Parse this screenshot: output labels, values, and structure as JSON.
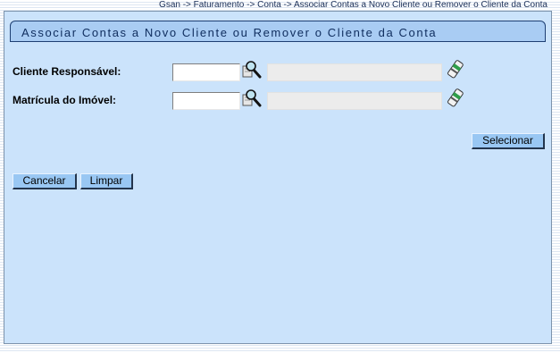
{
  "breadcrumb": "Gsan -> Faturamento -> Conta -> Associar Contas a Novo Cliente ou Remover o Cliente da Conta",
  "page": {
    "title": "Associar Contas a Novo Cliente ou Remover o Cliente da Conta"
  },
  "form": {
    "cliente_label": "Cliente Responsável:",
    "cliente_value": "",
    "cliente_name_value": "",
    "matricula_label": "Matrícula do Imóvel:",
    "matricula_value": "",
    "matricula_desc_value": ""
  },
  "buttons": {
    "selecionar": "Selecionar",
    "cancelar": "Cancelar",
    "limpar": "Limpar"
  },
  "icons": {
    "search": "search-icon",
    "eraser": "eraser-icon"
  }
}
